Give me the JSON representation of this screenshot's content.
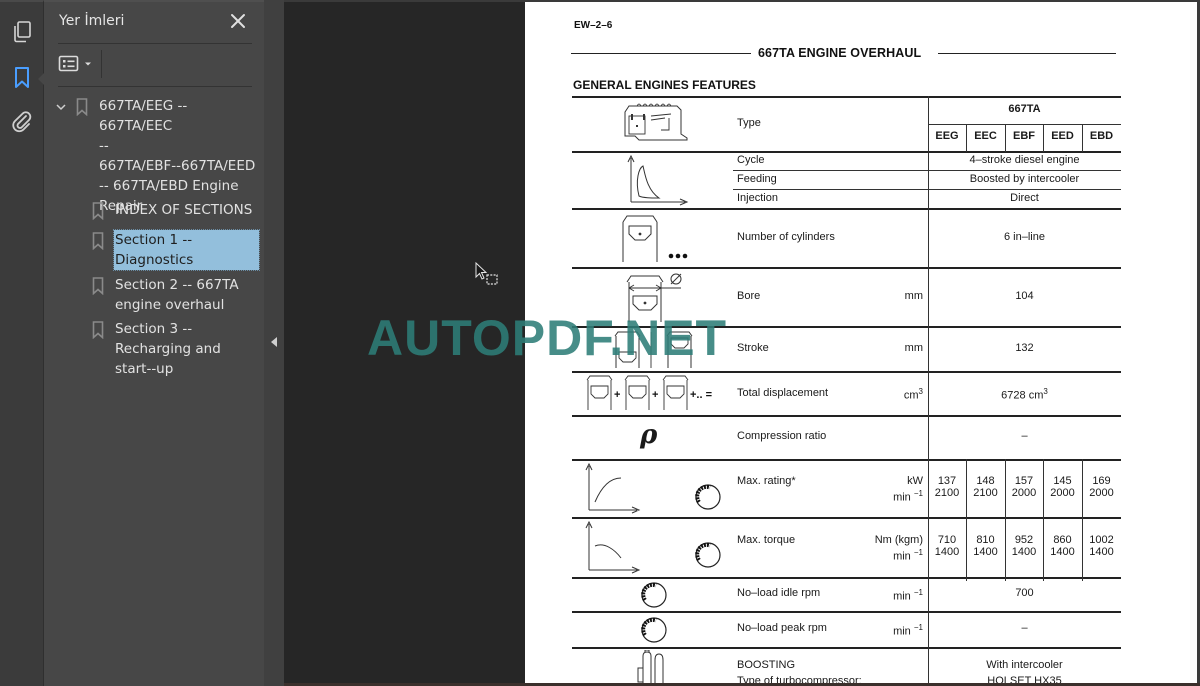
{
  "app": {
    "rail": {
      "icons": [
        {
          "name": "pages-icon",
          "label": "Page thumbnails"
        },
        {
          "name": "bookmark-icon",
          "label": "Bookmarks",
          "active": true
        },
        {
          "name": "attachment-icon",
          "label": "Attachments"
        }
      ],
      "active_color": "#4a9eff"
    },
    "bookmarks_panel": {
      "title": "Yer İmleri",
      "close_icon": "close-icon",
      "options_icon": "list-options-icon",
      "items": [
        {
          "label": "667TA/EEG -- 667TA/EEC\n--\n667TA/EBF--667TA/EED\n-- 667TA/EBD Engine\nRepair",
          "level": 0,
          "expanded": true
        },
        {
          "label": "INDEX OF SECTIONS",
          "level": 1
        },
        {
          "label": "Section 1 --\nDiagnostics",
          "level": 1,
          "selected": true
        },
        {
          "label": "Section 2 -- 667TA\nengine overhaul",
          "level": 1
        },
        {
          "label": "Section 3 --\nRecharging and\nstart--up",
          "level": 1
        }
      ]
    },
    "selection_color": "#93bfdc"
  },
  "document": {
    "page_code": "EW–2–6",
    "title": "667TA ENGINE OVERHAUL",
    "subtitle": "GENERAL ENGINES FEATURES",
    "table": {
      "model": "667TA",
      "variants": [
        "EEG",
        "EEC",
        "EBF",
        "EED",
        "EBD"
      ],
      "rows": {
        "type": {
          "label": "Type"
        },
        "cycle": {
          "label": "Cycle",
          "value": "4–stroke diesel engine"
        },
        "feeding": {
          "label": "Feeding",
          "value": "Boosted by intercooler"
        },
        "injection": {
          "label": "Injection",
          "value": "Direct"
        },
        "cylinders": {
          "label": "Number of cylinders",
          "value": "6 in–line"
        },
        "bore": {
          "label": "Bore",
          "unit": "mm",
          "value": "104"
        },
        "stroke": {
          "label": "Stroke",
          "unit": "mm",
          "value": "132"
        },
        "displacement": {
          "label": "Total displacement",
          "unit": "cm",
          "unit_sup": "3",
          "value": "6728 cm",
          "value_sup": "3"
        },
        "compression": {
          "label": "Compression ratio",
          "value": "–"
        },
        "max_rating": {
          "label": "Max. rating*",
          "unit1": "kW",
          "unit2": "min",
          "unit2_sup": "−1",
          "values": [
            [
              "137",
              "2100"
            ],
            [
              "148",
              "2100"
            ],
            [
              "157",
              "2000"
            ],
            [
              "145",
              "2000"
            ],
            [
              "169",
              "2000"
            ]
          ]
        },
        "max_torque": {
          "label": "Max. torque",
          "unit1": "Nm (kgm)",
          "unit2": "min",
          "unit2_sup": "−1",
          "values": [
            [
              "710",
              "1400"
            ],
            [
              "810",
              "1400"
            ],
            [
              "952",
              "1400"
            ],
            [
              "860",
              "1400"
            ],
            [
              "1002",
              "1400"
            ]
          ]
        },
        "idle_rpm": {
          "label": "No–load idle rpm",
          "unit": "min",
          "unit_sup": "−1",
          "value": "700"
        },
        "peak_rpm": {
          "label": "No–load peak rpm",
          "unit": "min",
          "unit_sup": "−1",
          "value": "–"
        },
        "boosting": {
          "label": "BOOSTING",
          "value": "With intercooler"
        },
        "turbo": {
          "label": "Type of turbocompressor:",
          "value": "HOLSET HX35"
        }
      }
    },
    "compression_symbol": "ρ"
  },
  "watermark": "AUTOPDF.NET"
}
